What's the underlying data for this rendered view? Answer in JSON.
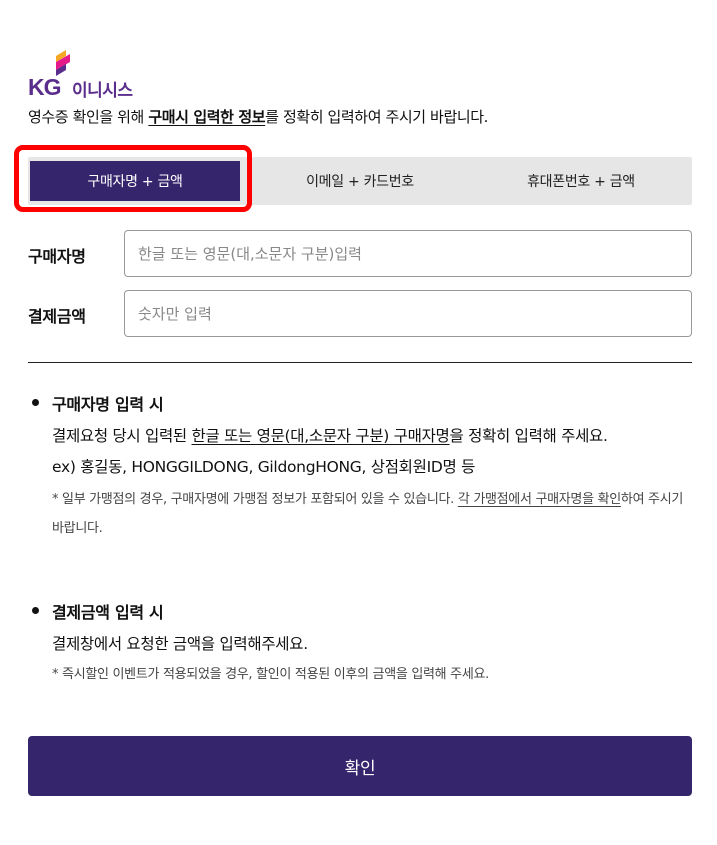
{
  "brand": {
    "logo_prefix": "KG",
    "logo_name": "이니시스",
    "accent_color": "#35256c"
  },
  "intro": {
    "text_before": "영수증 확인을 위해 ",
    "text_emphasis": "구매시 입력한 정보",
    "text_after": "를 정확히 입력하여 주시기 바랍니다."
  },
  "tabs": [
    {
      "label": "구매자명 + 금액",
      "selected": true
    },
    {
      "label": "이메일 + 카드번호",
      "selected": false
    },
    {
      "label": "휴대폰번호 + 금액",
      "selected": false
    }
  ],
  "form": {
    "buyer_name": {
      "label": "구매자명",
      "placeholder": "한글 또는 영문(대,소문자 구분)입력",
      "value": ""
    },
    "amount": {
      "label": "결제금액",
      "placeholder": "숫자만 입력",
      "value": ""
    }
  },
  "guide": {
    "name_section": {
      "title": "구매자명 입력 시",
      "line1_before": "결제요청 당시 입력된 ",
      "line1_underlined": "한글 또는 영문(대,소문자 구분) 구매자명",
      "line1_after": "을 정확히 입력해 주세요.",
      "example": "ex) 홍길동, HONGGILDONG, GildongHONG, 상점회원ID명 등",
      "note_before": "* 일부 가맹점의 경우, 구매자명에 가맹점 정보가 포함되어 있을 수 있습니다. ",
      "note_underlined": "각 가맹점에서 구매자명을 확인",
      "note_after": "하여 주시기 바랍니다."
    },
    "amount_section": {
      "title": "결제금액 입력 시",
      "line1": "결제창에서 요청한 금액을 입력해주세요.",
      "note": "* 즉시할인 이벤트가 적용되었을 경우, 할인이 적용된 이후의 금액을 입력해 주세요."
    }
  },
  "confirm_button": {
    "label": "확인"
  }
}
